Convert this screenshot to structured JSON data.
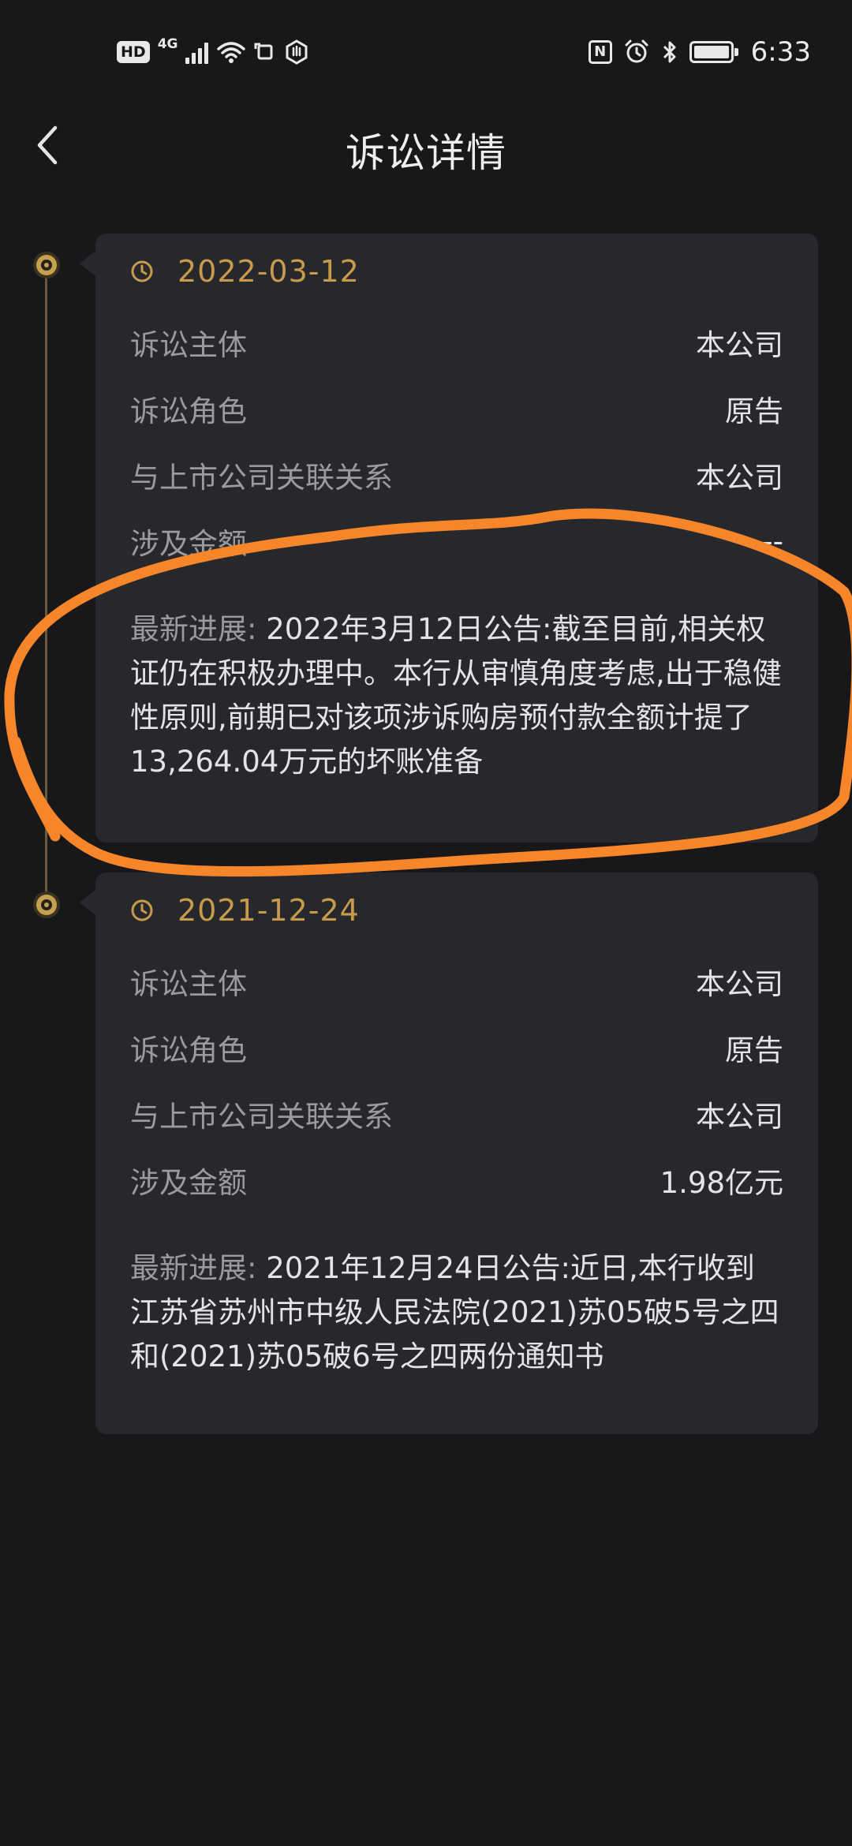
{
  "status_bar": {
    "hd": "HD",
    "network": "4G",
    "time": "6:33",
    "nfc": "N"
  },
  "header": {
    "title": "诉讼详情"
  },
  "cards": [
    {
      "date": "2022-03-12",
      "rows": [
        {
          "label": "诉讼主体",
          "value": "本公司"
        },
        {
          "label": "诉讼角色",
          "value": "原告"
        },
        {
          "label": "与上市公司关联关系",
          "value": "本公司"
        },
        {
          "label": "涉及金额",
          "value": "--"
        }
      ],
      "progress_label": "最新进展:",
      "progress_text": "2022年3月12日公告:截至目前,相关权证仍在积极办理中。本行从审慎角度考虑,出于稳健性原则,前期已对该项涉诉购房预付款全额计提了13,264.04万元的坏账准备"
    },
    {
      "date": "2021-12-24",
      "rows": [
        {
          "label": "诉讼主体",
          "value": "本公司"
        },
        {
          "label": "诉讼角色",
          "value": "原告"
        },
        {
          "label": "与上市公司关联关系",
          "value": "本公司"
        },
        {
          "label": "涉及金额",
          "value": "1.98亿元"
        }
      ],
      "progress_label": "最新进展:",
      "progress_text": "2021年12月24日公告:近日,本行收到江苏省苏州市中级人民法院(2021)苏05破5号之四和(2021)苏05破6号之四两份通知书"
    }
  ],
  "colors": {
    "background": "#18181b",
    "card": "#27282c",
    "accent_gold": "#c89b4c",
    "annotation_orange": "#f7852a"
  }
}
